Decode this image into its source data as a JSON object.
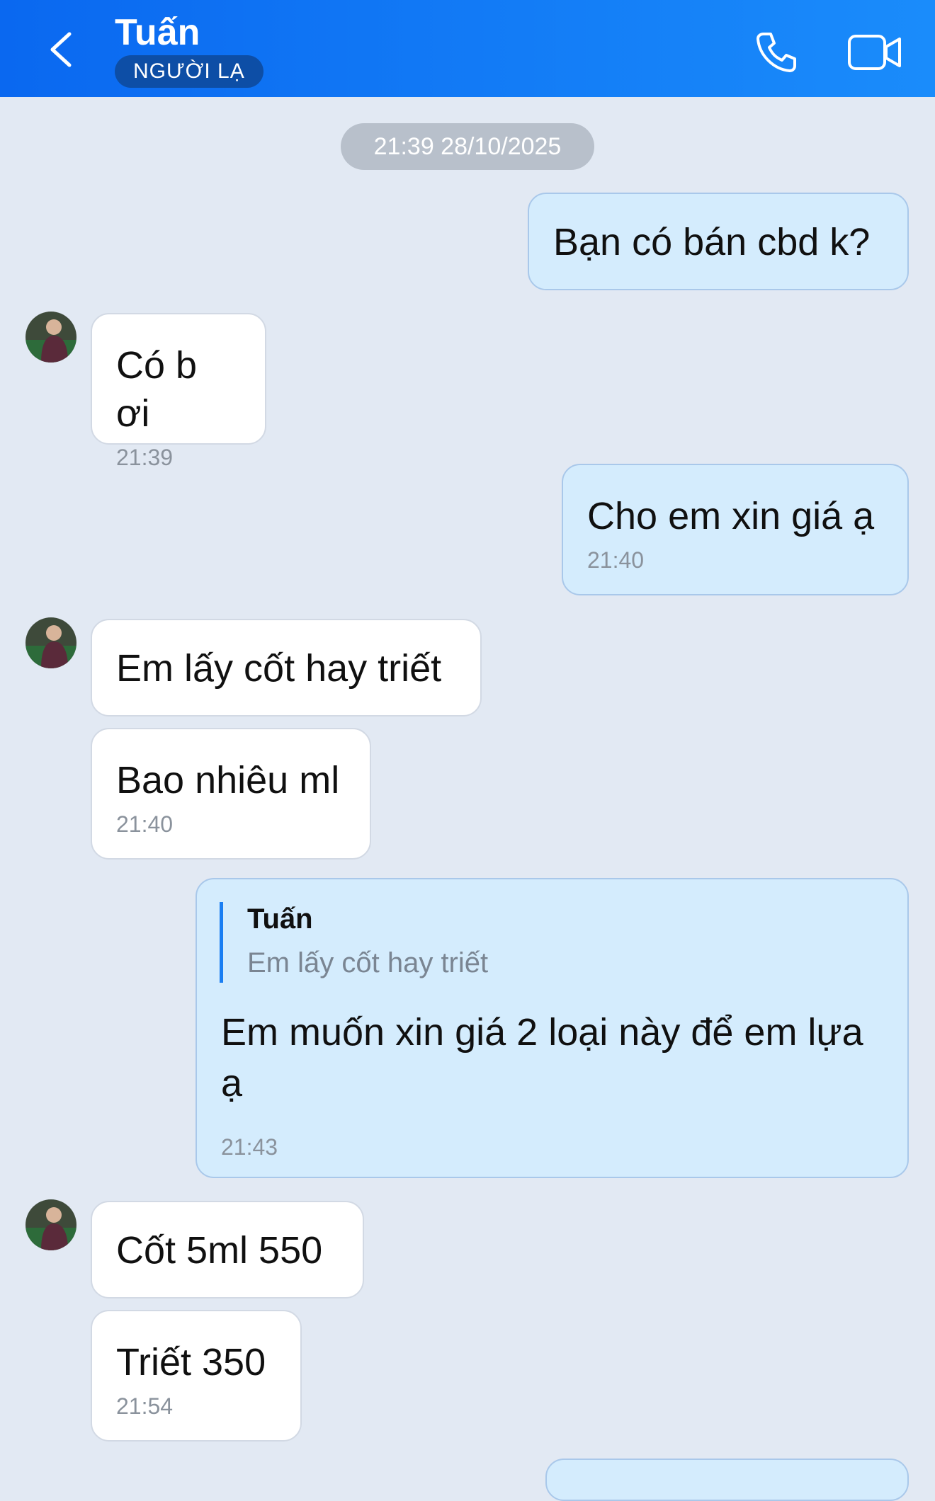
{
  "header": {
    "contact_name": "Tuấn",
    "badge": "NGƯỜI LẠ",
    "icons": [
      "back-icon",
      "phone-icon",
      "video-call-icon"
    ],
    "colors": {
      "header_start": "#0a68f0",
      "header_end": "#1a8cfb",
      "badge": "#0d4ea6"
    }
  },
  "chat": {
    "date_separator": "21:39 28/10/2025",
    "messages": [
      {
        "from": "me",
        "text": "Bạn có bán cbd k?"
      },
      {
        "from": "contact",
        "text": "Có b ơi",
        "time": "21:39"
      },
      {
        "from": "me",
        "text": "Cho em xin giá ạ",
        "time": "21:40"
      },
      {
        "from": "contact",
        "text": "Em lấy cốt hay triết"
      },
      {
        "from": "contact",
        "text": "Bao nhiêu ml",
        "time": "21:40"
      },
      {
        "from": "me",
        "reply_to": {
          "name": "Tuấn",
          "text": "Em lấy cốt hay triết"
        },
        "text_line1": "Em muốn xin giá 2 loại này để em lựa",
        "text_line2": "ạ",
        "time": "21:43"
      },
      {
        "from": "contact",
        "text": "Cốt 5ml 550"
      },
      {
        "from": "contact",
        "text": "Triết 350",
        "time": "21:54"
      }
    ],
    "colors": {
      "background": "#e2e9f3",
      "incoming": "#ffffff",
      "outgoing": "#d4ecfd"
    }
  }
}
